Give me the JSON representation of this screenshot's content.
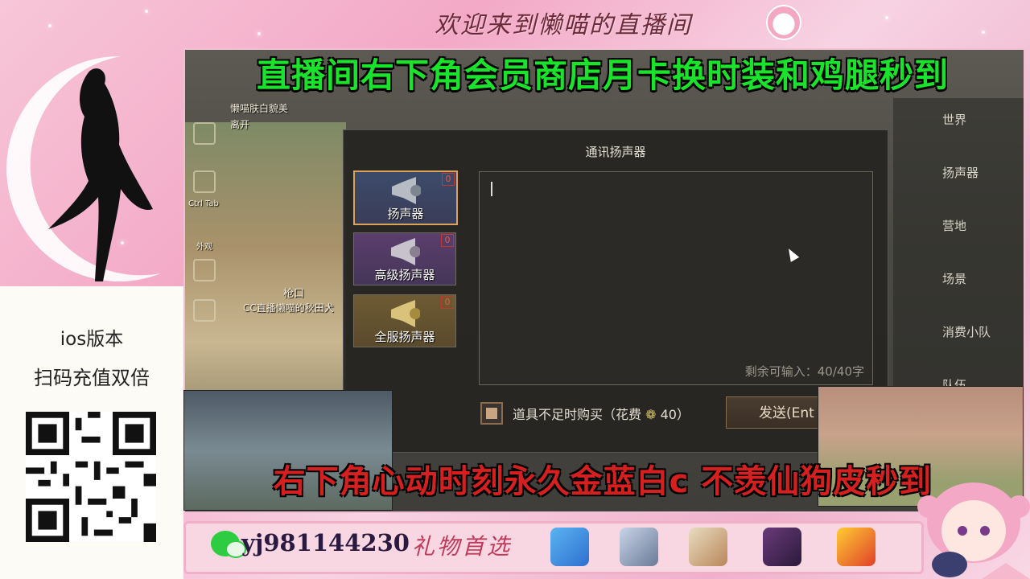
{
  "banner": {
    "welcome": "欢迎来到懒喵的直播间"
  },
  "left_panel": {
    "ios_label": "ios版本",
    "double_label": "扫码充值双倍"
  },
  "headline_top": "直播间右下角会员商店月卡换时装和鸡腿秒到",
  "headline_bottom": "右下角心动时刻永久金蓝白c 不羡仙狗皮秒到",
  "game": {
    "scene_texts": [
      "懒喵肤白貌美",
      "离开",
      "Ctrl Tab",
      "外观",
      "枪口",
      "CC直播懒喵的秋田犬"
    ],
    "channels": [
      "世界",
      "扬声器",
      "营地",
      "场景",
      "消费小队",
      "队伍"
    ],
    "dialog": {
      "title": "通讯扬声器",
      "items": [
        {
          "label": "扬声器",
          "count": "0"
        },
        {
          "label": "高级扬声器",
          "count": "0"
        },
        {
          "label": "全服扬声器",
          "count": "0"
        }
      ],
      "remaining": "剩余可输入：40/40字",
      "buy_label": "道具不足时购买（花费",
      "buy_cost": "40）",
      "send_label": "发送(Ent"
    }
  },
  "bottom_bar": {
    "wechat_id": "yj981144230",
    "gift_title": "礼物首选"
  },
  "colors": {
    "headline_top": "#19e32a",
    "headline_bottom": "#d62020",
    "accent_pink": "#f3a9c6"
  }
}
